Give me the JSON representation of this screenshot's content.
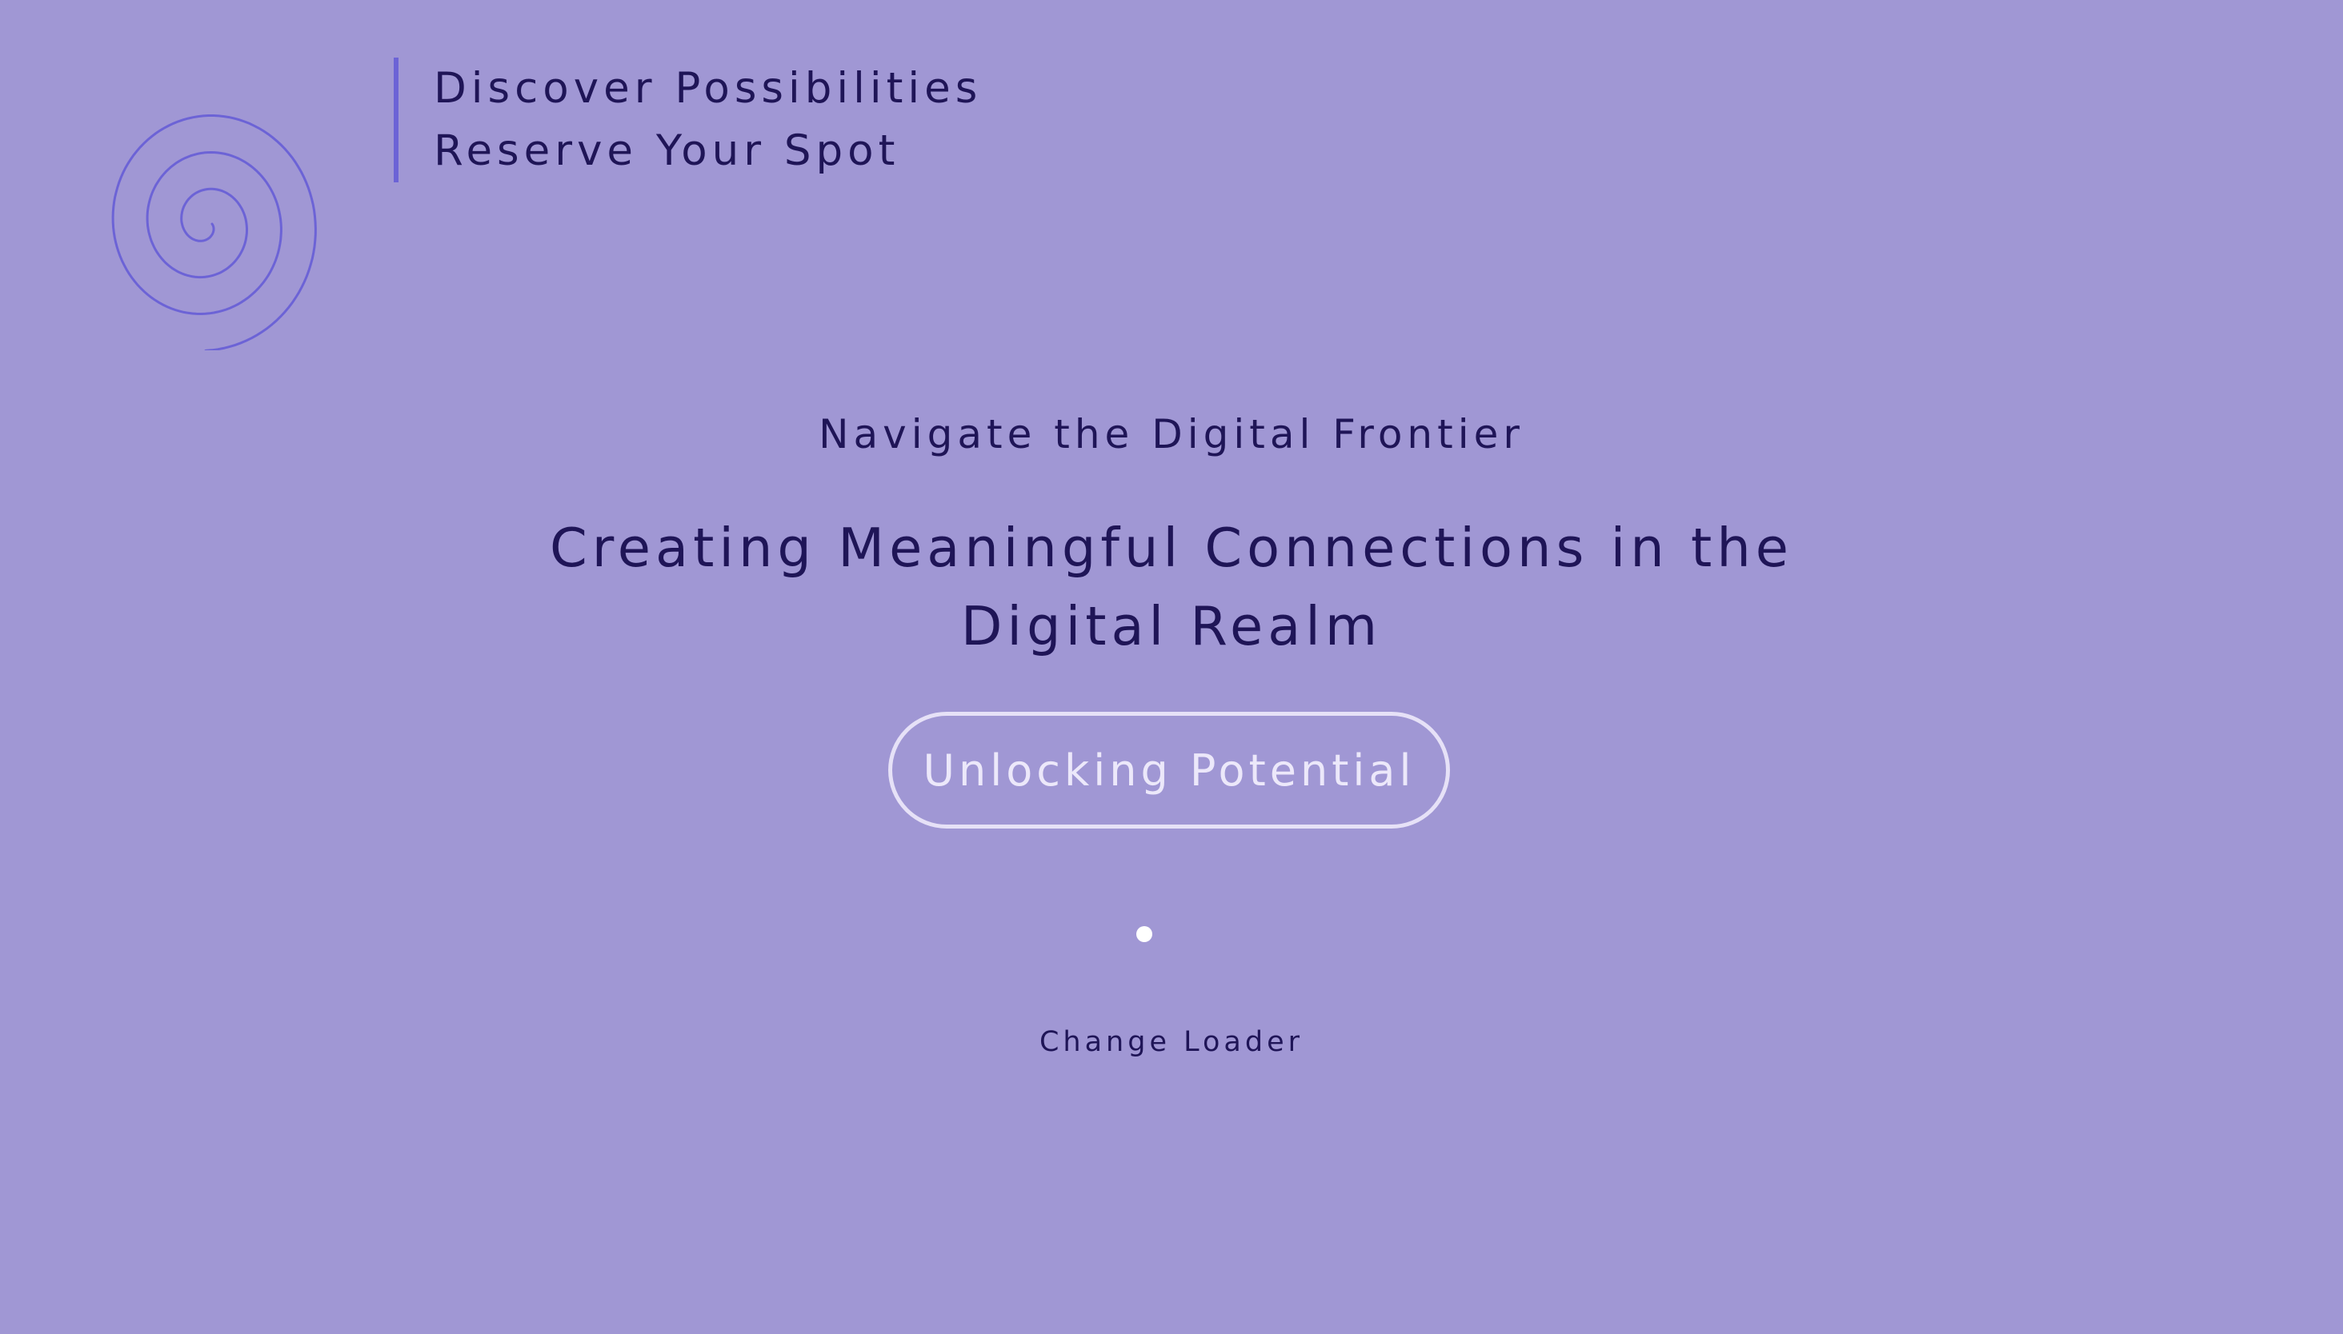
{
  "colors": {
    "background": "#a097d4",
    "text_dark": "#1f1557",
    "accent": "#6c63d6",
    "button_outline": "#e6e1f7",
    "loader_dot": "#ffffff"
  },
  "logo": {
    "icon": "spiral-icon"
  },
  "nav": {
    "items": [
      {
        "label": "Discover Possibilities"
      },
      {
        "label": "Reserve Your Spot"
      }
    ]
  },
  "hero": {
    "eyebrow": "Navigate the Digital Frontier",
    "headline_line1": "Creating Meaningful Connections in the",
    "headline_line2": "Digital Realm",
    "cta_label": "Unlocking Potential"
  },
  "loader": {
    "icon": "loader-dot",
    "change_label": "Change Loader"
  }
}
